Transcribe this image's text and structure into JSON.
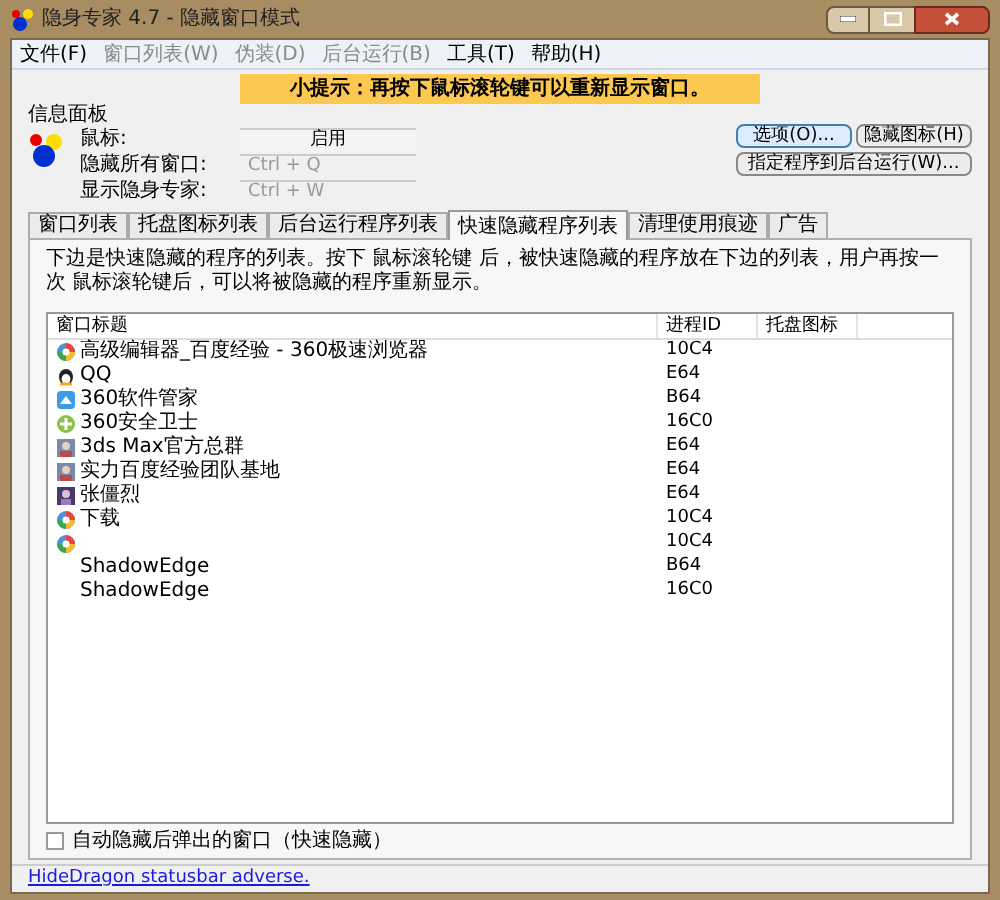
{
  "window": {
    "title": "隐身专家 4.7 - 隐藏窗口模式"
  },
  "menu": [
    {
      "label": "文件(F)",
      "disabled": false
    },
    {
      "label": "窗口列表(W)",
      "disabled": true
    },
    {
      "label": "伪装(D)",
      "disabled": true
    },
    {
      "label": "后台运行(B)",
      "disabled": true
    },
    {
      "label": "工具(T)",
      "disabled": false
    },
    {
      "label": "帮助(H)",
      "disabled": false
    }
  ],
  "tip": "小提示：再按下鼠标滚轮键可以重新显示窗口。",
  "info_panel": {
    "title": "信息面板",
    "rows": [
      {
        "label": "鼠标:",
        "value": "启用",
        "kind": "button",
        "disabled": false
      },
      {
        "label": "隐藏所有窗口:",
        "value": "Ctrl + Q",
        "kind": "hotkey",
        "disabled": true
      },
      {
        "label": "显示隐身专家:",
        "value": "Ctrl + W",
        "kind": "hotkey",
        "disabled": true
      }
    ]
  },
  "buttons": [
    {
      "label": "选项(O)...",
      "focused": true
    },
    {
      "label": "隐藏图标(H)",
      "focused": false
    },
    {
      "label": "指定程序到后台运行(W)...",
      "focused": false
    }
  ],
  "tabs": [
    {
      "label": "窗口列表",
      "selected": false
    },
    {
      "label": "托盘图标列表",
      "selected": false
    },
    {
      "label": "后台运行程序列表",
      "selected": false
    },
    {
      "label": "快速隐藏程序列表",
      "selected": true
    },
    {
      "label": "清理使用痕迹",
      "selected": false
    },
    {
      "label": "广告",
      "selected": false
    }
  ],
  "description": "下边是快速隐藏的程序的列表。按下 鼠标滚轮键 后，被快速隐藏的程序放在下边的列表，用户再按一次 鼠标滚轮键后，可以将被隐藏的程序重新显示。",
  "table": {
    "columns": [
      "窗口标题",
      "进程ID",
      "托盘图标"
    ],
    "rows": [
      {
        "title": "高级编辑器_百度经验 - 360极速浏览器",
        "pid": "10C4",
        "kind": "ball"
      },
      {
        "title": "QQ",
        "pid": "E64",
        "kind": "penguin"
      },
      {
        "title": "360软件管家",
        "pid": "B64",
        "kind": "app"
      },
      {
        "title": "360安全卫士",
        "pid": "16C0",
        "kind": "shield"
      },
      {
        "title": "3ds Max官方总群",
        "pid": "E64",
        "kind": "group"
      },
      {
        "title": "实力百度经验团队基地",
        "pid": "E64",
        "kind": "group"
      },
      {
        "title": "张僵烈",
        "pid": "E64",
        "kind": "person"
      },
      {
        "title": "下载",
        "pid": "10C4",
        "kind": "ball"
      },
      {
        "pid": "10C4",
        "kind": "ball"
      },
      {
        "title": "ShadowEdge",
        "pid": "B64",
        "kind": "plain"
      },
      {
        "title": "ShadowEdge",
        "pid": "16C0",
        "kind": "plain"
      }
    ]
  },
  "auto_hide": {
    "label": "自动隐藏后弹出的窗口（快速隐藏）",
    "checked": false
  },
  "status_bar": {
    "link": "HideDragon statusbar adverse."
  }
}
